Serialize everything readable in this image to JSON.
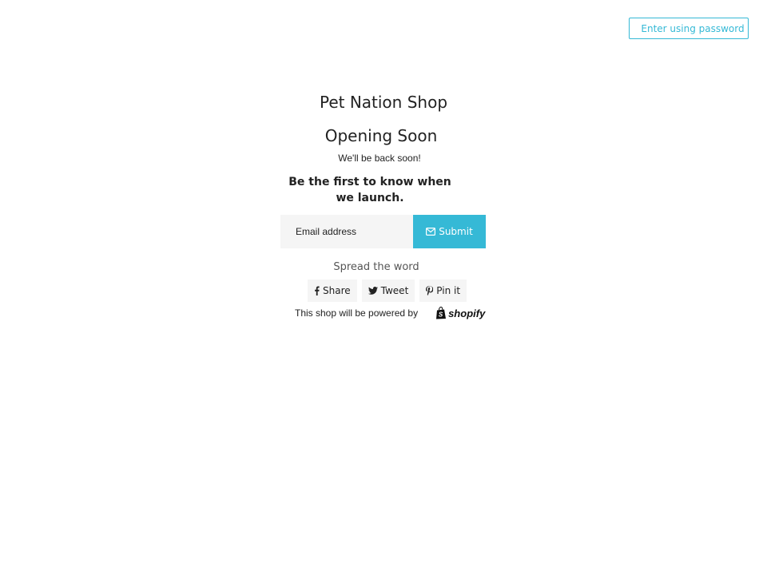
{
  "header": {
    "password_button_label": "Enter using password"
  },
  "main": {
    "shop_name": "Pet Nation Shop",
    "heading": "Opening Soon",
    "subtitle": "We'll be back soon!",
    "cta": "Be the first to know when we launch.",
    "email_placeholder": "Email address",
    "submit_label": "Submit"
  },
  "share": {
    "title": "Spread the word",
    "buttons": [
      {
        "label": "Share",
        "icon": "facebook-icon"
      },
      {
        "label": "Tweet",
        "icon": "twitter-icon"
      },
      {
        "label": "Pin it",
        "icon": "pinterest-icon"
      }
    ]
  },
  "footer": {
    "powered_text": "This shop will be powered by",
    "shopify_logo_text": "shopify"
  },
  "colors": {
    "accent": "#35b9d6",
    "input_bg": "#f5f5f5"
  }
}
